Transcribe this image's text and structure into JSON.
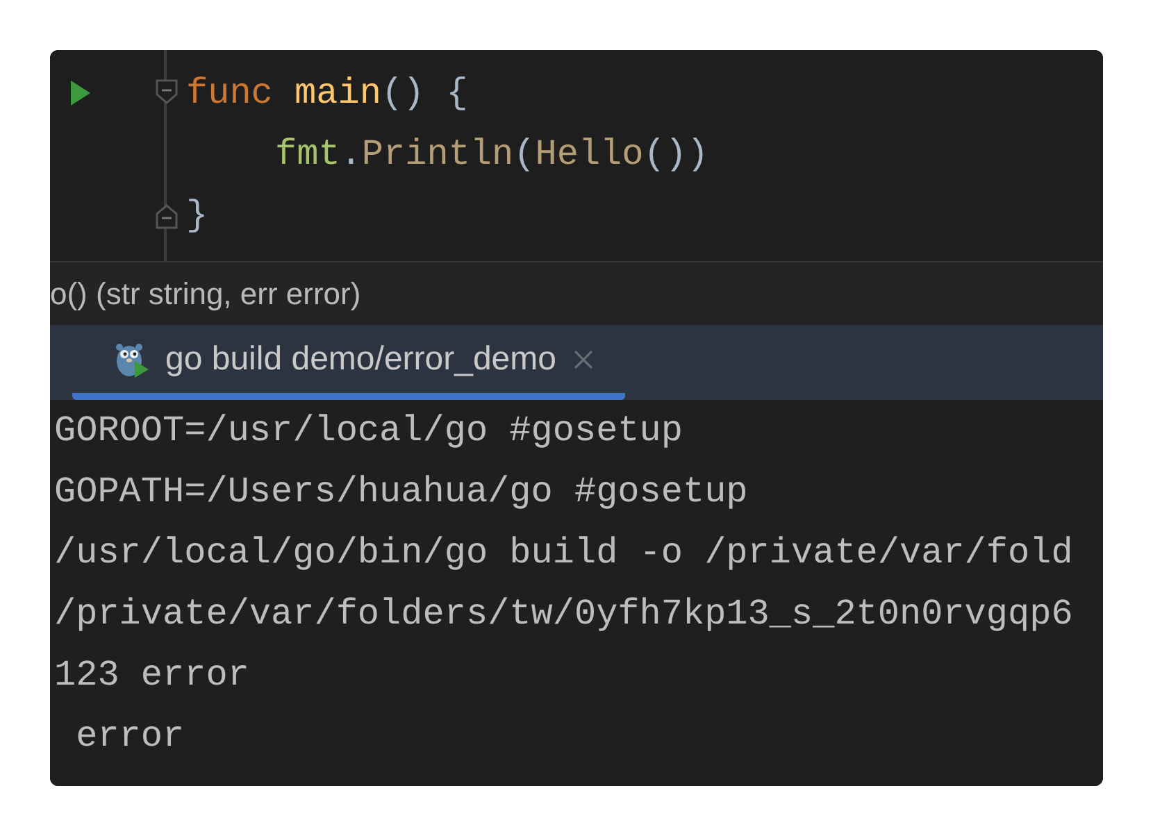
{
  "editor": {
    "lines": [
      {
        "run_icon": true,
        "fold_start": true,
        "fold_end": false,
        "indented": false,
        "tokens": [
          {
            "text": "func ",
            "kind": "keyword"
          },
          {
            "text": "main",
            "kind": "function"
          },
          {
            "text": "() {",
            "kind": "punct"
          }
        ]
      },
      {
        "run_icon": false,
        "fold_start": false,
        "fold_end": false,
        "indented": true,
        "tokens": [
          {
            "text": "fmt",
            "kind": "package"
          },
          {
            "text": ".",
            "kind": "punct"
          },
          {
            "text": "Println",
            "kind": "call"
          },
          {
            "text": "(",
            "kind": "punct"
          },
          {
            "text": "Hello",
            "kind": "call"
          },
          {
            "text": "())",
            "kind": "punct"
          }
        ]
      },
      {
        "run_icon": false,
        "fold_start": false,
        "fold_end": true,
        "indented": false,
        "tokens": [
          {
            "text": "}",
            "kind": "punct"
          }
        ]
      }
    ]
  },
  "breadcrumb": "o() (str string, err error)",
  "run_tabs": [
    {
      "label": "go build demo/error_demo",
      "selected": true
    }
  ],
  "console": {
    "lines": [
      "GOROOT=/usr/local/go #gosetup",
      "GOPATH=/Users/huahua/go #gosetup",
      "/usr/local/go/bin/go build -o /private/var/fold",
      "/private/var/folders/tw/0yfh7kp13_s_2t0n0rvgqp6",
      "123 error",
      " error"
    ]
  }
}
